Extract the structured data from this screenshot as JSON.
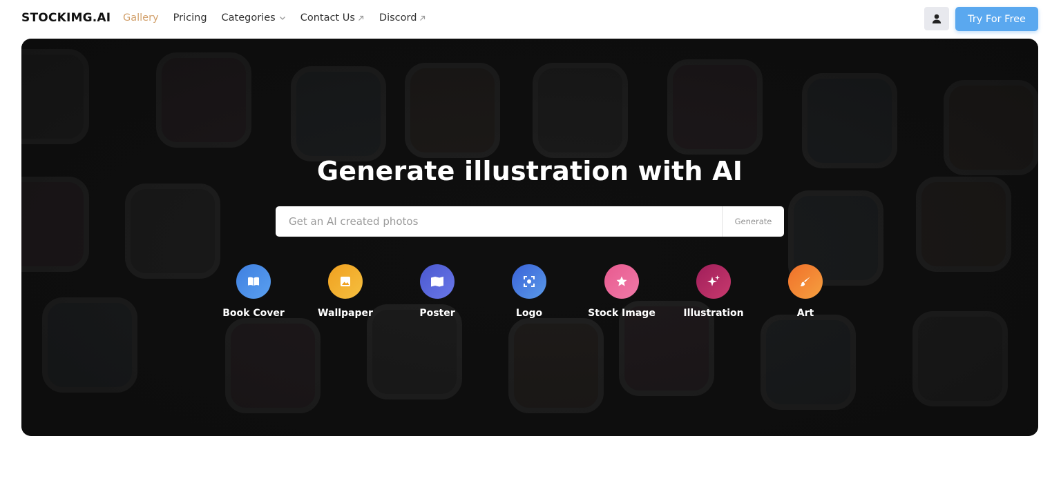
{
  "header": {
    "logo": "STOCKIMG.AI",
    "nav": [
      {
        "label": "Gallery",
        "active": true,
        "chevron": false,
        "external": false
      },
      {
        "label": "Pricing",
        "active": false,
        "chevron": false,
        "external": false
      },
      {
        "label": "Categories",
        "active": false,
        "chevron": true,
        "external": false
      },
      {
        "label": "Contact Us",
        "active": false,
        "chevron": false,
        "external": true
      },
      {
        "label": "Discord",
        "active": false,
        "chevron": false,
        "external": true
      }
    ],
    "user_icon": "user-icon",
    "cta_label": "Try For Free"
  },
  "hero": {
    "title": "Generate illustration  with AI",
    "search": {
      "placeholder": "Get an AI created photos",
      "value": "",
      "button_label": "Generate"
    },
    "categories": [
      {
        "label": "Book Cover",
        "icon": "book-icon",
        "color_from": "#3f7fe0",
        "color_to": "#5aa0f0"
      },
      {
        "label": "Wallpaper",
        "icon": "image-icon",
        "color_from": "#f0a020",
        "color_to": "#f6c040"
      },
      {
        "label": "Poster",
        "icon": "map-icon",
        "color_from": "#4a58d0",
        "color_to": "#6a78e8"
      },
      {
        "label": "Logo",
        "icon": "focus-icon",
        "color_from": "#3a62d8",
        "color_to": "#5a9ae8"
      },
      {
        "label": "Stock Image",
        "icon": "star-icon",
        "color_from": "#e85a8f",
        "color_to": "#f07aa8"
      },
      {
        "label": "Illustration",
        "icon": "sparkles-icon",
        "color_from": "#a01e5a",
        "color_to": "#c83a6e"
      },
      {
        "label": "Art",
        "icon": "brush-icon",
        "color_from": "#f0702a",
        "color_to": "#f6a040"
      }
    ]
  },
  "colors": {
    "accent": "#5aa8ef",
    "nav_active": "#d2a06b",
    "hero_bg": "#121212"
  }
}
